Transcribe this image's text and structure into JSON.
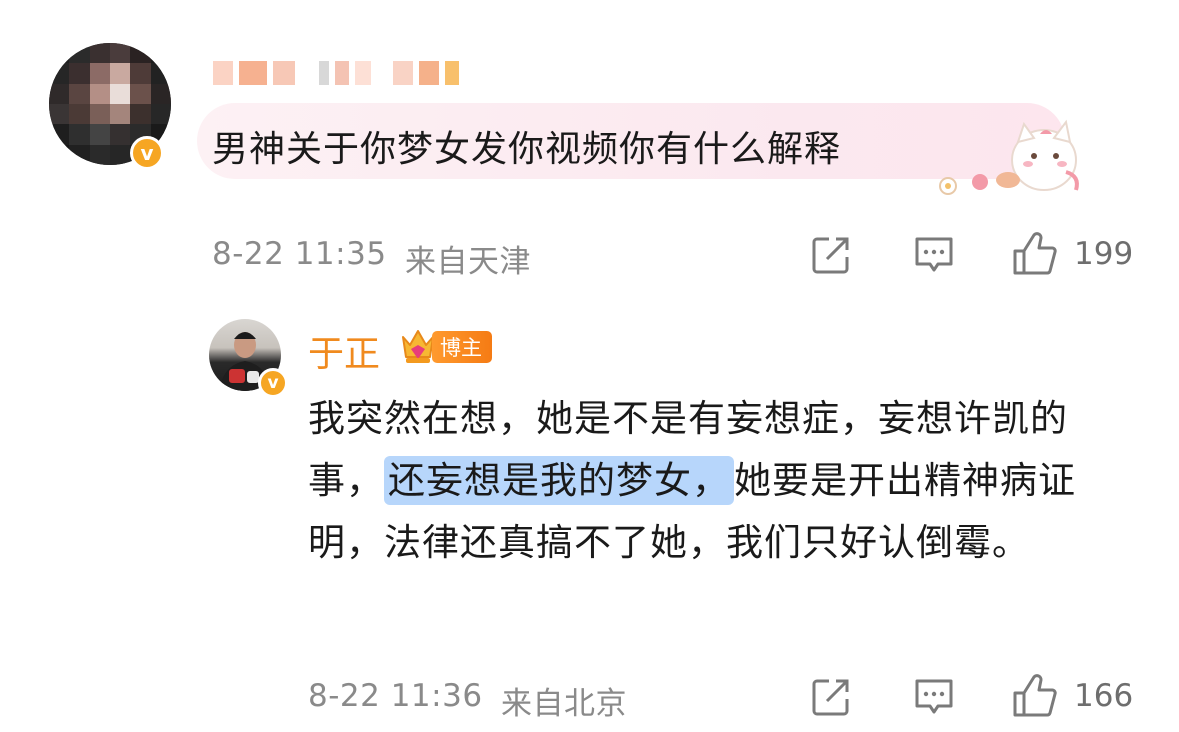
{
  "comment": {
    "text": "男神关于你梦女发你视频你有什么解释",
    "time": "8-22 11:35",
    "location": "来自天津",
    "likes": "199",
    "verified_badge": "v"
  },
  "reply": {
    "author": "于正",
    "badge": "博主",
    "text_before": "我突然在想，她是不是有妄想症，妄想许凯的事，",
    "text_highlight": "还妄想是我的梦女，",
    "text_after": "她要是开出精神病证明，法律还真搞不了她，我们只好认倒霉。",
    "time": "8-22 11:36",
    "location": "来自北京",
    "likes": "166",
    "verified_badge": "v"
  },
  "icons": {
    "share": "share-icon",
    "comment": "comment-icon",
    "like": "thumbs-up-icon",
    "highlight_color": "#b7d6fb",
    "name_color": "#f08a1e"
  }
}
